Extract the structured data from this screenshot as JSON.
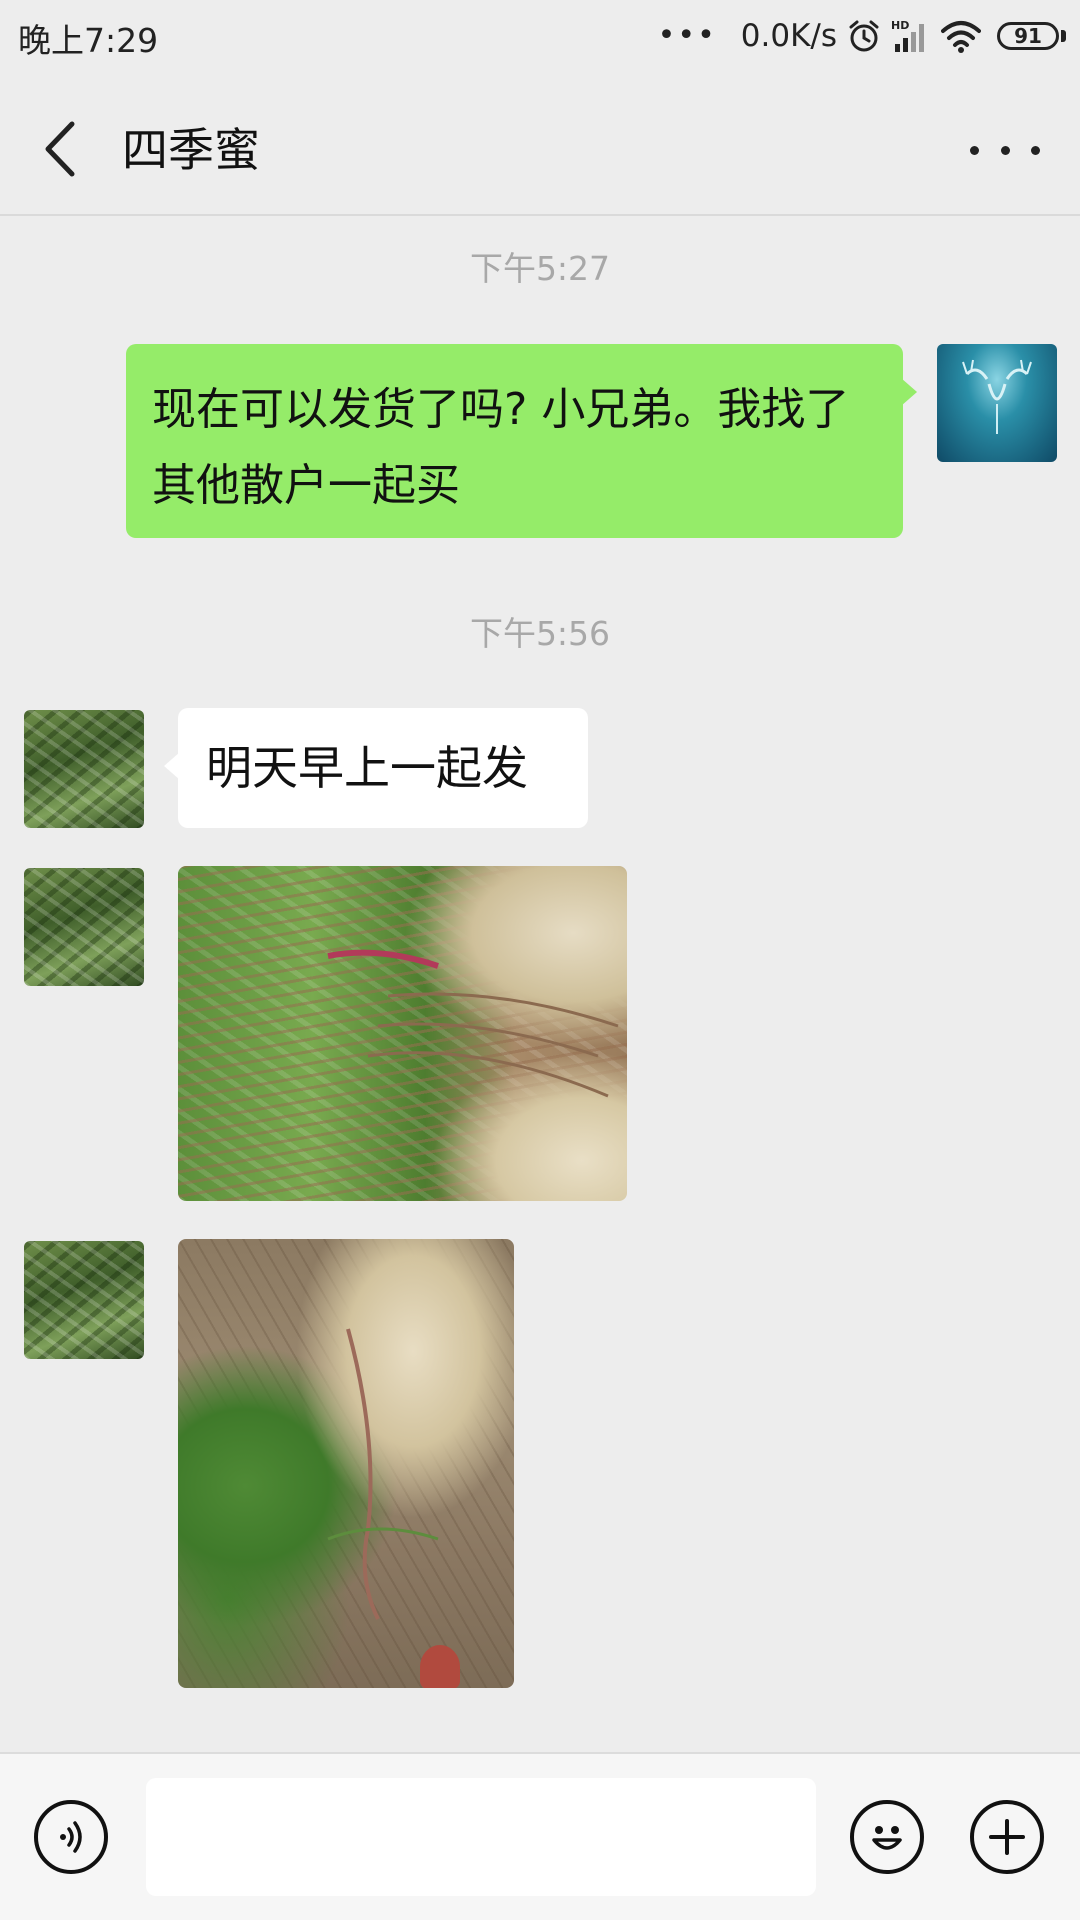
{
  "status_bar": {
    "time": "晚上7:29",
    "network_speed": "0.0K/s",
    "battery": "91",
    "icons": [
      "more-dots-icon",
      "alarm-icon",
      "hd-signal-icon",
      "wifi-icon",
      "battery-icon"
    ]
  },
  "header": {
    "title": "四季蜜",
    "icons": [
      "back-arrow-icon",
      "more-icon"
    ]
  },
  "messages": [
    {
      "type": "timestamp",
      "text": "下午5:27"
    },
    {
      "type": "text",
      "side": "outgoing",
      "text": "现在可以发货了吗? 小兄弟。我找了其他散户一起买"
    },
    {
      "type": "timestamp",
      "text": "下午5:56"
    },
    {
      "type": "text",
      "side": "incoming",
      "text": "明天早上一起发"
    },
    {
      "type": "image",
      "side": "incoming",
      "subject": "bundled plant seedlings with roots"
    },
    {
      "type": "image",
      "side": "incoming",
      "subject": "plant seedlings on dirt ground"
    }
  ],
  "colors": {
    "background": "#ededed",
    "outgoing_bubble": "#95ec69",
    "incoming_bubble": "#ffffff",
    "timestamp_text": "#a8a8a8"
  },
  "input_bar": {
    "value": "",
    "icons": [
      "voice-icon",
      "emoji-icon",
      "plus-icon"
    ]
  }
}
